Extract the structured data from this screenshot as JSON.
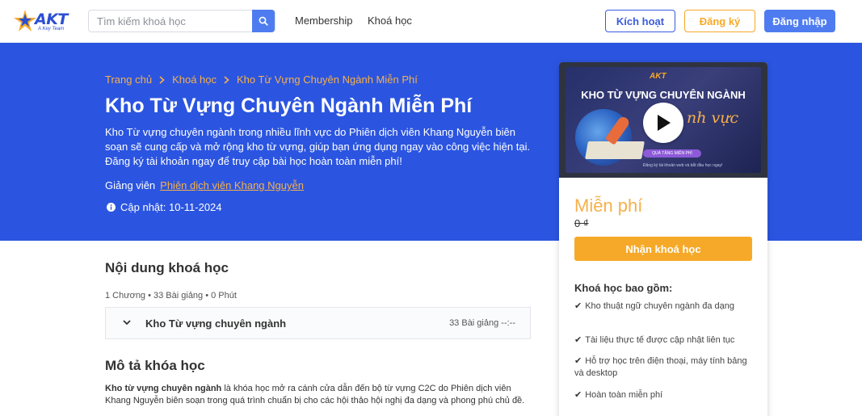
{
  "header": {
    "logo_text": "AKT",
    "logo_tagline": "A Key Team",
    "search_placeholder": "Tìm kiếm khoá học",
    "nav": [
      "Membership",
      "Khoá học"
    ],
    "activate_label": "Kích hoạt",
    "register_label": "Đăng ký",
    "login_label": "Đăng nhập"
  },
  "hero": {
    "breadcrumb": [
      "Trang chủ",
      "Khoá học",
      "Kho Từ Vựng Chuyên Ngành Miễn Phí"
    ],
    "title": "Kho Từ Vựng Chuyên Ngành Miễn Phí",
    "description": "Kho Từ vựng chuyên ngành trong nhiều lĩnh vực do Phiên dịch viên Khang Nguyễn biên soạn sẽ cung cấp và mở rộng kho từ vựng, giúp bạn ứng dụng ngay vào công việc hiện tại. Đăng ký tài khoản ngay để truy cập bài học hoàn toàn miễn phí!",
    "instructor_label": "Giảng viên",
    "instructor_name": "Phiên dịch viên Khang Nguyễn",
    "updated": "Cập nhật: 10-11-2024"
  },
  "card": {
    "thumbnail": {
      "logo": "AKT",
      "title": "KHO TỪ VỰNG CHUYÊN NGÀNH",
      "subtitle": "nh vực",
      "pill": "QUÀ TẶNG MIỄN PHÍ",
      "note": "Đăng ký tài khoản web và bắt đầu học ngay!"
    },
    "price": "Miễn phí",
    "old_price": "0 ₫",
    "enroll_label": "Nhận khoá học",
    "includes_title": "Khoá học bao gồm:",
    "includes": [
      "Kho thuật ngữ chuyên ngành đa dạng",
      "Tài liệu thực tế được cập nhật liên tục",
      "Hỗ trợ học trên điện thoại, máy tính bảng và desktop",
      "Hoàn toàn miễn phí"
    ]
  },
  "content": {
    "section_title": "Nội dung khoá học",
    "meta": "1 Chương • 33 Bài giảng • 0 Phút",
    "chapter_title": "Kho Từ vựng chuyên ngành",
    "chapter_meta": "33 Bài giảng --:--",
    "description_title": "Mô tả khóa học",
    "description_bold": "Kho từ vựng chuyên ngành",
    "description_text": " là khóa học mở ra cánh cửa dẫn đến bộ từ vựng C2C do Phiên dịch viên Khang Nguyễn biên soạn trong quá trình chuẩn bị cho các hội thảo hội nghị đa dạng và phong phú chủ đề."
  },
  "colors": {
    "brand_blue": "#2b55e0",
    "accent_orange": "#f6a928",
    "link_orange": "#f6b04b"
  }
}
